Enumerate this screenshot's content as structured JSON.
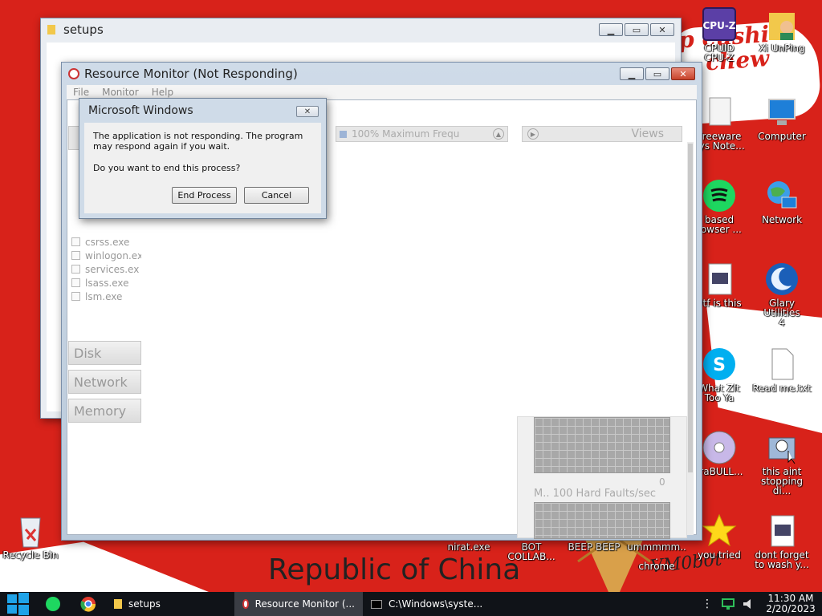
{
  "wallpaper": {
    "bottom_text": "Republic of China",
    "slogan_lines": [
      "p cushi",
      "chew"
    ],
    "signature": "VM0b0t"
  },
  "desktop_icons": [
    {
      "name": "cpuz",
      "label": "CPUID\nCPU-Z",
      "icon": "cpu-z-icon"
    },
    {
      "name": "xiunping",
      "label": "Xi UnPing",
      "icon": "user-folder-icon"
    },
    {
      "name": "freeware-notes",
      "label": "Freeware\nsys Note...",
      "icon": "notes-icon"
    },
    {
      "name": "computer",
      "label": "Computer",
      "icon": "computer-icon"
    },
    {
      "name": "based-browser",
      "label": "based\nrowser ...",
      "icon": "spotify-icon"
    },
    {
      "name": "network",
      "label": "Network",
      "icon": "network-icon"
    },
    {
      "name": "wtf-is-this",
      "label": "vtf is this",
      "icon": "document-icon"
    },
    {
      "name": "glary-utilities",
      "label": "Glary Utilities\n4",
      "icon": "glary-icon"
    },
    {
      "name": "what-zit",
      "label": "What Zit\nToo Ya",
      "icon": "skype-icon"
    },
    {
      "name": "read-me",
      "label": "Read me.txt",
      "icon": "text-file-icon"
    },
    {
      "name": "ultrabull",
      "label": "traBULL...",
      "icon": "disc-icon"
    },
    {
      "name": "this-aint-stopping",
      "label": "this aint\nstopping di...",
      "icon": "installer-icon"
    },
    {
      "name": "recycle-bin",
      "label": "Recycle Bin",
      "icon": "recycle-bin-icon"
    },
    {
      "name": "nirat",
      "label": "nirat.exe",
      "icon": "exe-icon"
    },
    {
      "name": "bot-collab",
      "label": "BOT\nCOLLAB...",
      "icon": "shortcut-icon"
    },
    {
      "name": "beep-beep",
      "label": "BEEP BEEP",
      "icon": "shortcut-icon"
    },
    {
      "name": "ummmmm-chrome",
      "label": "ummmmm...\nchrome",
      "icon": "chrome-icon"
    },
    {
      "name": "you-tried",
      "label": "you tried",
      "icon": "star-icon"
    },
    {
      "name": "dont-forget",
      "label": "dont forget\nto wash y...",
      "icon": "document-icon"
    }
  ],
  "setups_window": {
    "title": "setups"
  },
  "resmon": {
    "title": "Resource Monitor (Not Responding)",
    "menu": [
      "File",
      "Monitor",
      "Help"
    ],
    "processes": [
      "csrss.exe",
      "winlogon.ex",
      "services.ex",
      "lsass.exe",
      "lsm.exe"
    ],
    "sections": [
      "Disk",
      "Network",
      "Memory"
    ],
    "cpu_freq": "100% Maximum Frequ",
    "views_label": "Views",
    "graph_zero": "0",
    "graph_caption": "M.. 100 Hard Faults/sec"
  },
  "dialog": {
    "title": "Microsoft Windows",
    "message": "The application is not responding. The program may respond again if you wait.",
    "question": "Do you want to end this process?",
    "end_button": "End Process",
    "cancel_button": "Cancel"
  },
  "taskbar": {
    "tasks": [
      {
        "label": "setups",
        "icon": "folder-icon"
      },
      {
        "label": "Resource Monitor (...",
        "icon": "resmon-icon"
      },
      {
        "label": "C:\\Windows\\syste...",
        "icon": "cmd-icon"
      }
    ],
    "time": "11:30 AM",
    "date": "2/20/2023"
  },
  "colors": {
    "wallpaper_red": "#d8221a",
    "taskbar": "#101318",
    "window_frame": "#cfdbe8"
  }
}
